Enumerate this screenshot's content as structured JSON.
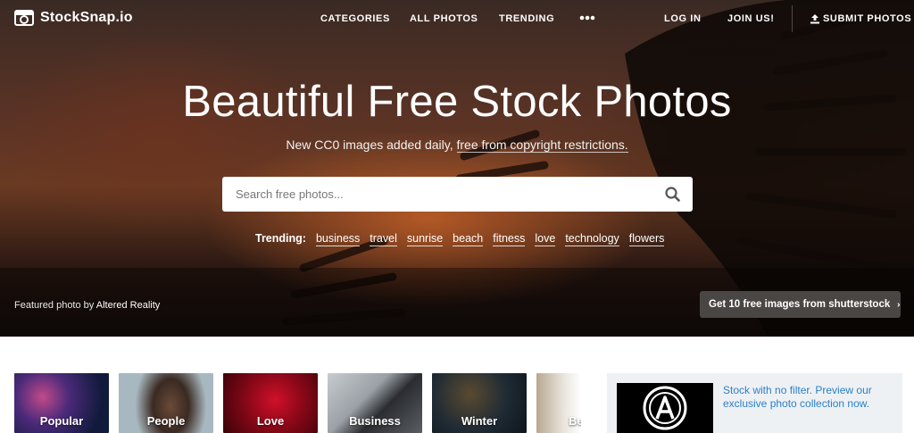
{
  "brand": {
    "name": "StockSnap.io"
  },
  "nav": {
    "categories": "CATEGORIES",
    "all_photos": "ALL PHOTOS",
    "trending": "TRENDING",
    "login": "LOG IN",
    "join": "JOIN US!",
    "submit": "SUBMIT PHOTOS"
  },
  "hero": {
    "title": "Beautiful Free Stock Photos",
    "subtitle_prefix": "New CC0 images added daily, ",
    "subtitle_link": "free from copyright restrictions.",
    "search_placeholder": "Search free photos...",
    "trending_label": "Trending:",
    "trending_tags": [
      "business",
      "travel",
      "sunrise",
      "beach",
      "fitness",
      "love",
      "technology",
      "flowers"
    ],
    "featured_prefix": "Featured photo by ",
    "featured_author": "Altered Reality",
    "shutterstock_cta": "Get 10 free images from shutterstock"
  },
  "categories": [
    {
      "label": "Popular"
    },
    {
      "label": "People"
    },
    {
      "label": "Love"
    },
    {
      "label": "Business"
    },
    {
      "label": "Winter"
    },
    {
      "label": "Be"
    }
  ],
  "promo": {
    "text": "Stock with no filter. Preview our exclusive photo collection now."
  },
  "icons": {
    "logo": "camera-icon",
    "more": "more-dots-icon",
    "submit": "upload-icon",
    "search": "search-icon",
    "cta": "chevron-right-icon",
    "promo": "brand-a-logo-icon"
  },
  "colors": {
    "promo_link": "#2b7fc8",
    "cta_bg": "#4a4644"
  }
}
